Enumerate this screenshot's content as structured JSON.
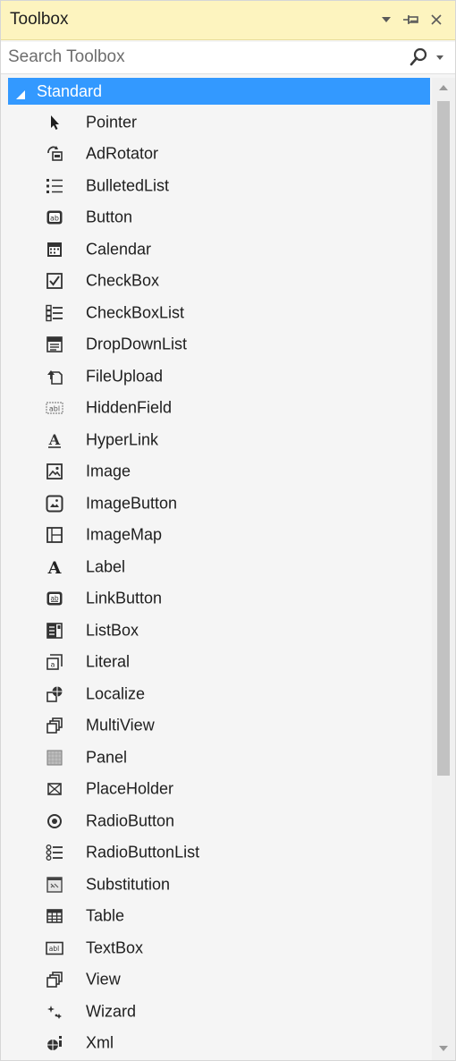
{
  "titlebar": {
    "title": "Toolbox"
  },
  "search": {
    "placeholder": "Search Toolbox"
  },
  "group": {
    "label": "Standard"
  },
  "items": [
    {
      "label": "Pointer",
      "icon": "pointer-icon"
    },
    {
      "label": "AdRotator",
      "icon": "adrotator-icon"
    },
    {
      "label": "BulletedList",
      "icon": "bulleted-list-icon"
    },
    {
      "label": "Button",
      "icon": "button-icon"
    },
    {
      "label": "Calendar",
      "icon": "calendar-icon"
    },
    {
      "label": "CheckBox",
      "icon": "checkbox-icon"
    },
    {
      "label": "CheckBoxList",
      "icon": "checkbox-list-icon"
    },
    {
      "label": "DropDownList",
      "icon": "dropdown-list-icon"
    },
    {
      "label": "FileUpload",
      "icon": "file-upload-icon"
    },
    {
      "label": "HiddenField",
      "icon": "hidden-field-icon"
    },
    {
      "label": "HyperLink",
      "icon": "hyperlink-icon"
    },
    {
      "label": "Image",
      "icon": "image-icon"
    },
    {
      "label": "ImageButton",
      "icon": "image-button-icon"
    },
    {
      "label": "ImageMap",
      "icon": "image-map-icon"
    },
    {
      "label": "Label",
      "icon": "label-icon"
    },
    {
      "label": "LinkButton",
      "icon": "link-button-icon"
    },
    {
      "label": "ListBox",
      "icon": "listbox-icon"
    },
    {
      "label": "Literal",
      "icon": "literal-icon"
    },
    {
      "label": "Localize",
      "icon": "localize-icon"
    },
    {
      "label": "MultiView",
      "icon": "multiview-icon"
    },
    {
      "label": "Panel",
      "icon": "panel-icon"
    },
    {
      "label": "PlaceHolder",
      "icon": "placeholder-icon"
    },
    {
      "label": "RadioButton",
      "icon": "radio-button-icon"
    },
    {
      "label": "RadioButtonList",
      "icon": "radio-button-list-icon"
    },
    {
      "label": "Substitution",
      "icon": "substitution-icon"
    },
    {
      "label": "Table",
      "icon": "table-icon"
    },
    {
      "label": "TextBox",
      "icon": "textbox-icon"
    },
    {
      "label": "View",
      "icon": "view-icon"
    },
    {
      "label": "Wizard",
      "icon": "wizard-icon"
    },
    {
      "label": "Xml",
      "icon": "xml-icon"
    }
  ],
  "colors": {
    "titlebar_bg": "#fdf4bf",
    "selection": "#3399ff",
    "scroll_thumb": "#c2c2c2"
  }
}
